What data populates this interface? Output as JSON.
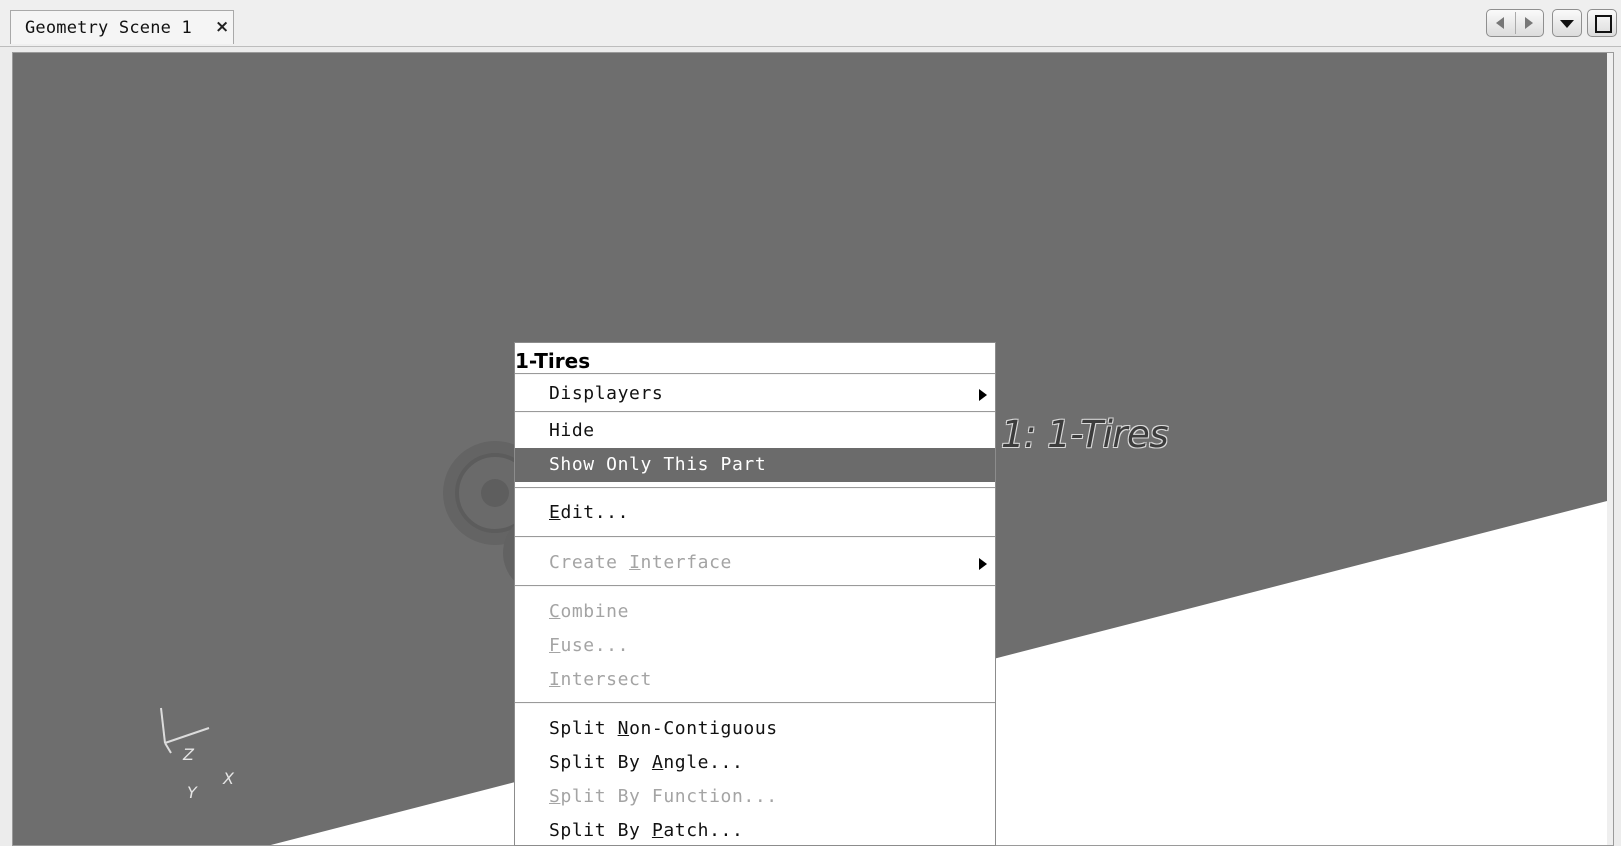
{
  "tab": {
    "title": "Geometry Scene 1",
    "close_glyph": "×"
  },
  "toolbar": {
    "nav_prev_icon": "chevron-left-icon",
    "nav_next_icon": "chevron-right-icon",
    "dropdown_icon": "chevron-down-icon",
    "maximize_icon": "maximize-icon"
  },
  "scene": {
    "background_color": "#6e6e6e",
    "ground_color": "#ffffff",
    "part_label": "1: 1-Tires",
    "triad": {
      "z": "Z",
      "y": "Y",
      "x": "X"
    }
  },
  "context_menu": {
    "title": "1-Tires",
    "items": [
      {
        "label": "Displayers",
        "submenu": true,
        "enabled": true
      },
      {
        "label": "Hide",
        "enabled": true
      },
      {
        "label": "Show Only This Part",
        "enabled": true,
        "selected": true
      },
      {
        "label": "Edit...",
        "mnemonic_pre": "",
        "mnemonic": "E",
        "mnemonic_post": "dit...",
        "enabled": true
      },
      {
        "label": "Create Interface",
        "mnemonic_pre": "Create ",
        "mnemonic": "I",
        "mnemonic_post": "nterface",
        "submenu": true,
        "enabled": false
      },
      {
        "label": "Combine",
        "mnemonic_pre": "",
        "mnemonic": "C",
        "mnemonic_post": "ombine",
        "enabled": false
      },
      {
        "label": "Fuse...",
        "mnemonic_pre": "",
        "mnemonic": "F",
        "mnemonic_post": "use...",
        "enabled": false
      },
      {
        "label": "Intersect",
        "mnemonic_pre": "",
        "mnemonic": "I",
        "mnemonic_post": "ntersect",
        "enabled": false
      },
      {
        "label": "Split Non-Contiguous",
        "mnemonic_pre": "Split ",
        "mnemonic": "N",
        "mnemonic_post": "on-Contiguous",
        "enabled": true
      },
      {
        "label": "Split By Angle...",
        "mnemonic_pre": "Split By ",
        "mnemonic": "A",
        "mnemonic_post": "ngle...",
        "enabled": true
      },
      {
        "label": "Split By Function...",
        "mnemonic_pre": "",
        "mnemonic": "S",
        "mnemonic_post": "plit By Function...",
        "enabled": false
      },
      {
        "label": "Split By Patch...",
        "mnemonic_pre": "Split By ",
        "mnemonic": "P",
        "mnemonic_post": "atch...",
        "enabled": true
      }
    ]
  }
}
